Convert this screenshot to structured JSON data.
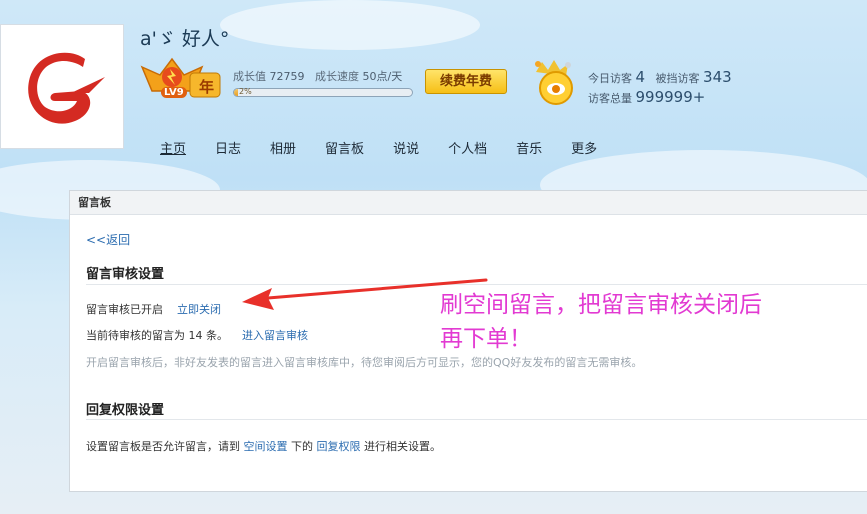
{
  "header": {
    "nickname": "a'ゞ 好人°",
    "level_label": "LV9",
    "year_badge": "年",
    "growth_value_label": "成长值",
    "growth_value": "72759",
    "growth_speed_label": "成长速度",
    "growth_speed": "50点/天",
    "progress_percent": 2,
    "progress_text": "2%",
    "renew_button": "续费年费",
    "today_visitors_label": "今日访客",
    "today_visitors": "4",
    "blocked_visitors_label": "被挡访客",
    "blocked_visitors": "343",
    "total_visitors_label": "访客总量",
    "total_visitors": "999999+"
  },
  "nav": {
    "items": [
      "主页",
      "日志",
      "相册",
      "留言板",
      "说说",
      "个人档",
      "音乐",
      "更多"
    ],
    "active_index": 0
  },
  "panel": {
    "title": "留言板",
    "back_label": "返回",
    "review_section_title": "留言审核设置",
    "review_status_text": "留言审核已开启",
    "close_now_link": "立即关闭",
    "pending_text": "当前待审核的留言为 14 条。",
    "enter_review_link": "进入留言审核",
    "review_note": "开启留言审核后，非好友发表的留言进入留言审核库中，待您审阅后方可显示，您的QQ好友发布的留言无需审核。",
    "reply_section_title": "回复权限设置",
    "reply_text_before": "设置留言板是否允许留言，请到",
    "space_settings_link": "空间设置",
    "reply_text_mid": "下的",
    "reply_permission_link": "回复权限",
    "reply_text_after": "进行相关设置。"
  },
  "annotation": {
    "text_line1": "刷空间留言，把留言审核关闭后",
    "text_line2": "再下单！",
    "color": "#e23ad2",
    "arrow_color": "#e8302a"
  }
}
